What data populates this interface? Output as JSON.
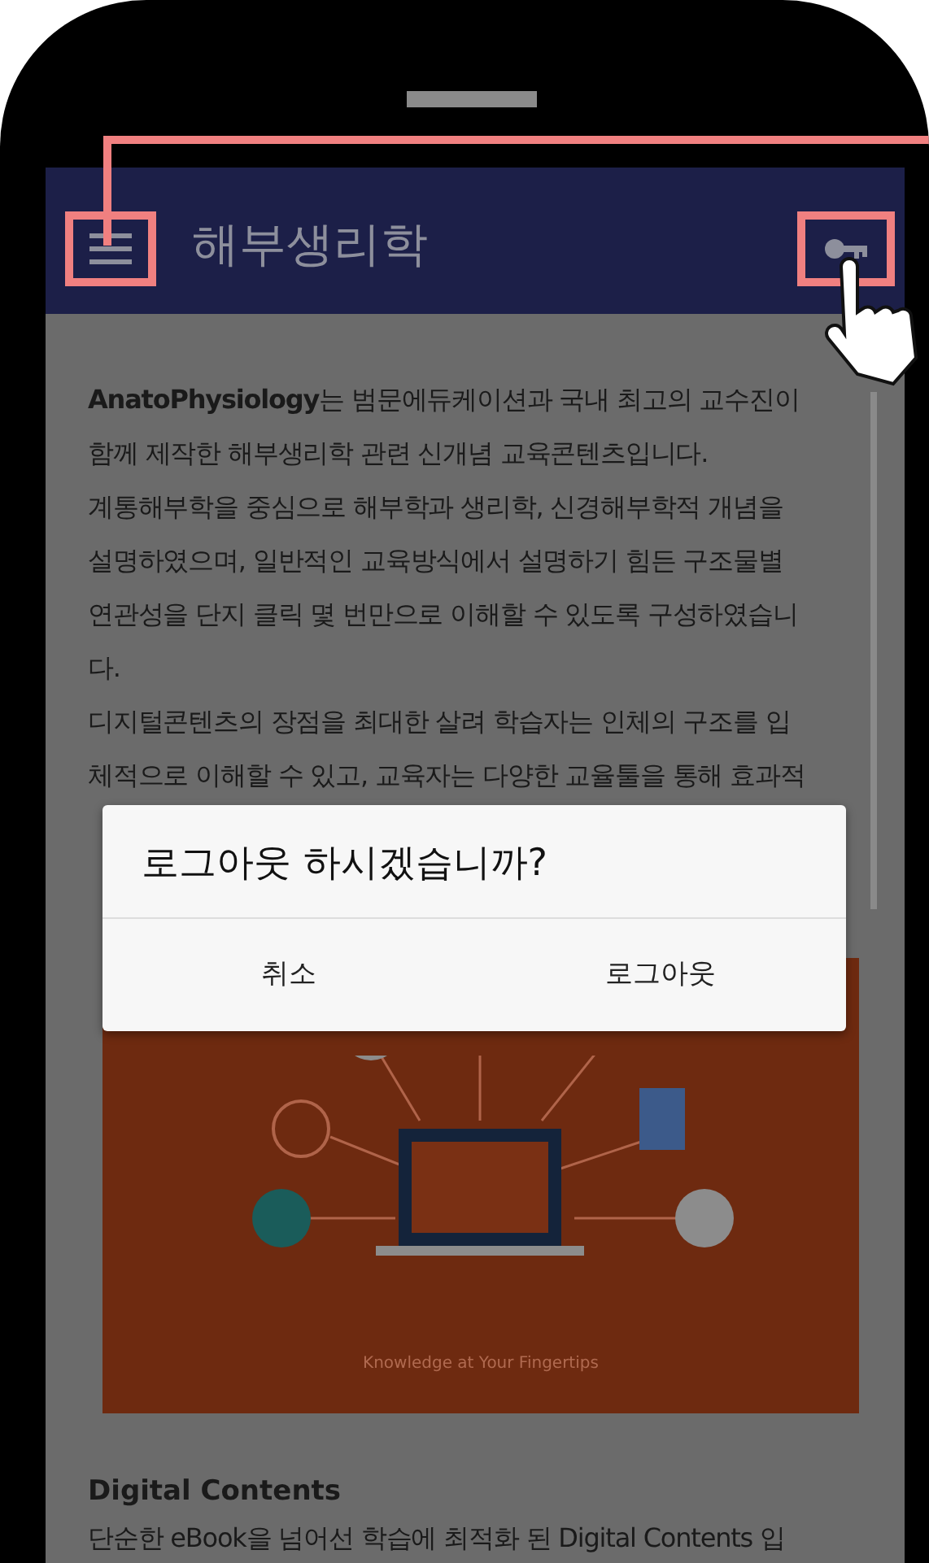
{
  "app_bar": {
    "title": "해부생리학"
  },
  "content": {
    "intro_lines": [
      "**AnatoPhysiology**는 범문에듀케이션과 국내 최고의 교수진이",
      "함께 제작한 해부생리학 관련 신개념 교육콘텐츠입니다.",
      "계통해부학을 중심으로 해부학과 생리학, 신경해부학적 개념을",
      "설명하였으며, 일반적인 교육방식에서 설명하기 힘든 구조물별",
      "연관성을 단지 클릭 몇 번만으로 이해할 수 있도록 구성하였습니",
      "다.",
      "디지털콘텐츠의 장점을 최대한 살려 학습자는 인체의 구조를 입",
      "체적으로 이해할 수 있고, 교육자는 다양한 교율툴을 통해 효과적"
    ],
    "illustration": {
      "caption": "Knowledge at Your Fingertips"
    },
    "section": {
      "heading": "Digital Contents",
      "text": "단순한 eBook을 넘어선 학습에 최적화 된 Digital Contents 입"
    }
  },
  "dialog": {
    "message": "로그아웃 하시겠습니까?",
    "buttons": [
      "취소",
      "로그아웃"
    ]
  }
}
